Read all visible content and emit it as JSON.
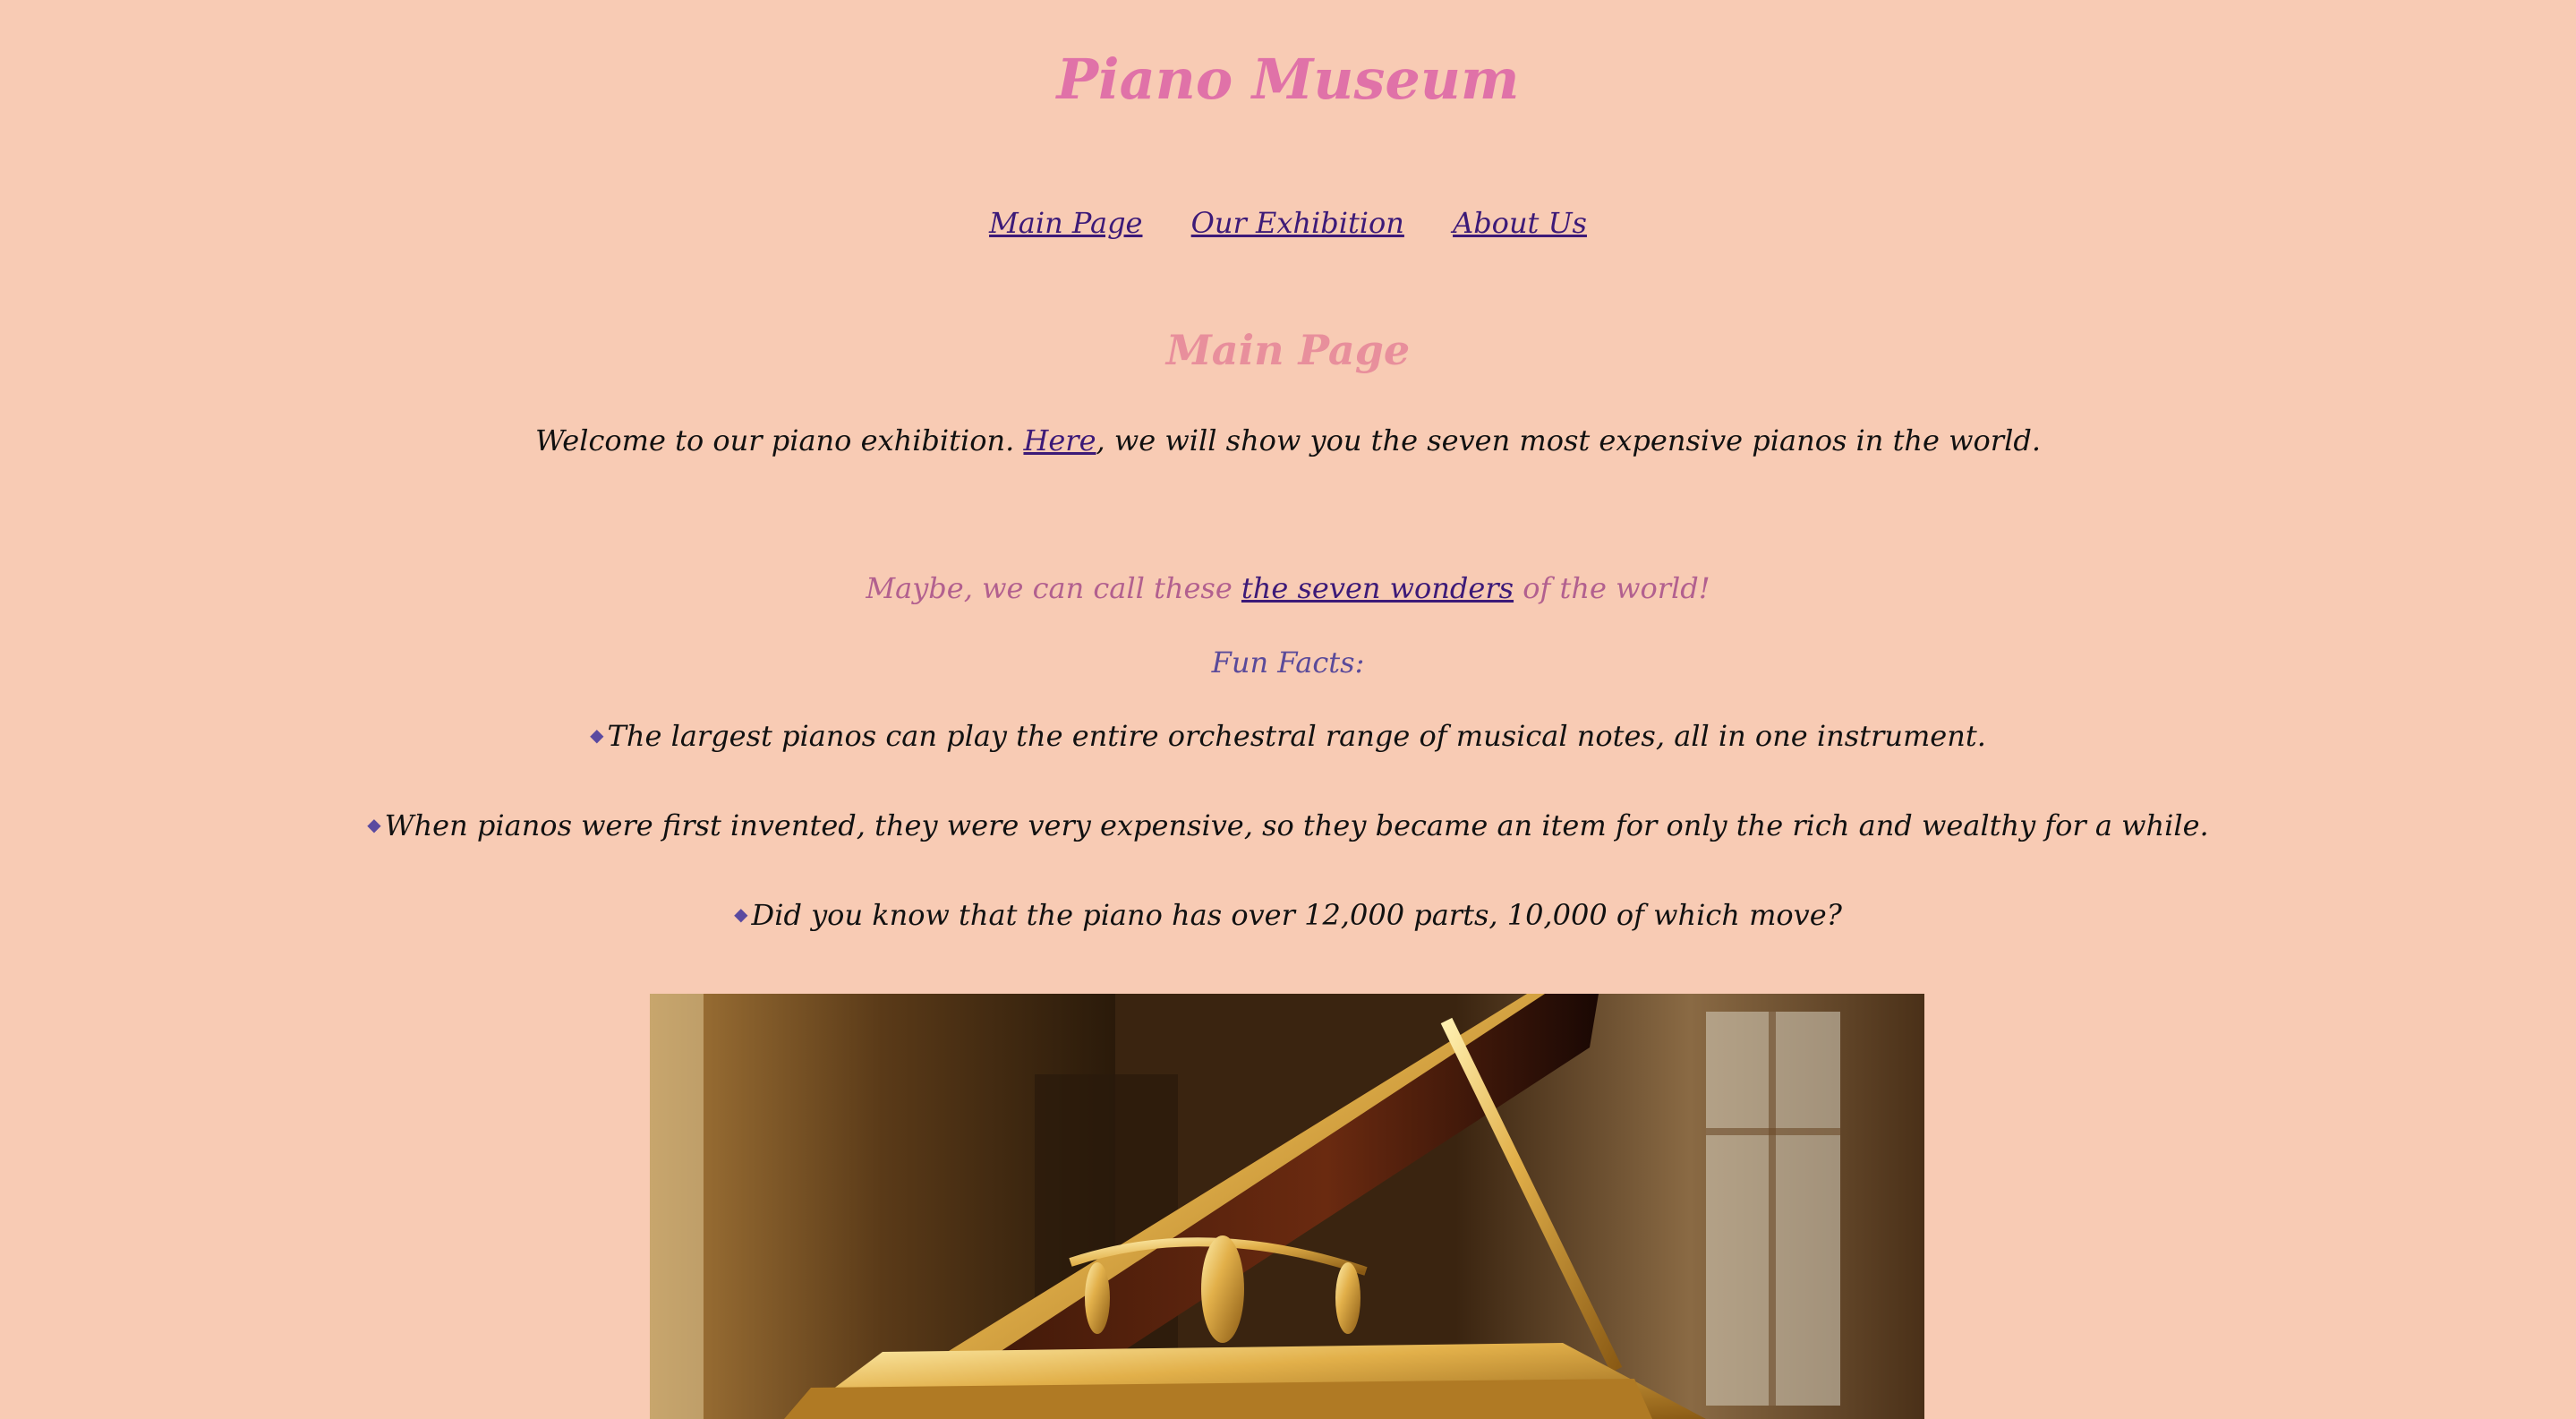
{
  "site": {
    "title": "Piano Museum"
  },
  "nav": {
    "items": [
      {
        "label": "Main Page"
      },
      {
        "label": "Our Exhibition"
      },
      {
        "label": "About Us"
      }
    ]
  },
  "main": {
    "heading": "Main Page",
    "intro": {
      "before": "Welcome to our piano exhibition. ",
      "link": "Here",
      "after": ", we will show you the seven most expensive pianos in the world."
    },
    "tagline": {
      "before": "Maybe, we can call these ",
      "link": "the seven wonders",
      "after": " of the world!"
    },
    "facts_heading": "Fun Facts:",
    "facts": [
      "The largest pianos can play the entire orchestral range of musical notes, all in one instrument.",
      "When pianos were first invented, they were very expensive, so they became an item for only the rich and wealthy for a while.",
      "Did you know that the piano has over 12,000 parts, 10,000 of which move?"
    ],
    "bullet_icon": "diamond-bullet-icon"
  },
  "colors": {
    "background": "#f8cbb4",
    "title": "#e072a8",
    "heading": "#e88f9c",
    "link": "#3c1a78",
    "tagline": "#b2608f",
    "facts_heading": "#5a4a9a",
    "body_text": "#111111"
  }
}
